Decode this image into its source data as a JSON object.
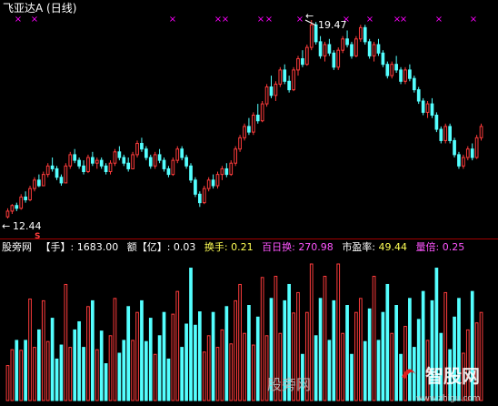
{
  "window": {
    "title": "飞亚达A (日线)"
  },
  "price_panel": {
    "high_label": "19.47",
    "low_label": "12.44",
    "signal_marker": "S",
    "x_marker_glyph": "×",
    "x_marker_count": 13
  },
  "info_bar": {
    "source": "股旁网",
    "volume_label": "【手】: 1683.00",
    "amount_label": "额【亿】: 0.03",
    "turnover_label": "换手: 0.21",
    "hundred_day_label": "百日换: ",
    "hundred_day_value": "270.98",
    "pe_label": "市盈率: ",
    "pe_value": "49.44",
    "volume_ratio_label": "量倍: ",
    "volume_ratio_value": "0.25"
  },
  "watermarks": {
    "center": "股旁网",
    "right": "智股网",
    "right_url": "www.zhigu.com"
  },
  "colors": {
    "up": "#ff3c3c",
    "down": "#54ffff",
    "marker": "#ff00ff",
    "label": "#ffffff",
    "divider": "#a00000",
    "hundred_day": "#ff55ff",
    "pe": "#ffff55",
    "volume_ratio": "#ff55ff",
    "source": "#ffffff"
  },
  "chart_data": {
    "type": "candlestick",
    "price_range": [
      12.44,
      19.47
    ],
    "candles": [
      [
        12.5,
        12.8,
        12.44,
        12.7
      ],
      [
        12.7,
        12.95,
        12.6,
        12.9
      ],
      [
        12.9,
        13.0,
        12.7,
        12.8
      ],
      [
        12.8,
        13.3,
        12.75,
        13.2
      ],
      [
        13.2,
        13.4,
        13.0,
        13.1
      ],
      [
        13.1,
        13.6,
        13.05,
        13.5
      ],
      [
        13.5,
        13.9,
        13.4,
        13.8
      ],
      [
        13.8,
        14.0,
        13.55,
        13.6
      ],
      [
        13.6,
        14.1,
        13.6,
        14.0
      ],
      [
        14.0,
        14.4,
        13.9,
        14.3
      ],
      [
        14.3,
        14.6,
        14.1,
        14.2
      ],
      [
        14.2,
        14.3,
        13.8,
        13.9
      ],
      [
        13.9,
        14.0,
        13.6,
        13.7
      ],
      [
        13.7,
        14.4,
        13.7,
        14.3
      ],
      [
        14.3,
        14.8,
        14.2,
        14.7
      ],
      [
        14.7,
        14.9,
        14.4,
        14.5
      ],
      [
        14.5,
        14.6,
        14.2,
        14.3
      ],
      [
        14.3,
        14.5,
        14.0,
        14.1
      ],
      [
        14.1,
        14.7,
        14.05,
        14.6
      ],
      [
        14.6,
        14.8,
        14.3,
        14.4
      ],
      [
        14.4,
        14.6,
        14.2,
        14.5
      ],
      [
        14.5,
        14.6,
        14.2,
        14.3
      ],
      [
        14.3,
        14.4,
        14.0,
        14.1
      ],
      [
        14.1,
        14.5,
        14.0,
        14.4
      ],
      [
        14.4,
        14.9,
        14.3,
        14.8
      ],
      [
        14.8,
        15.0,
        14.5,
        14.6
      ],
      [
        14.6,
        14.7,
        14.3,
        14.4
      ],
      [
        14.4,
        14.6,
        14.1,
        14.2
      ],
      [
        14.2,
        14.8,
        14.2,
        14.7
      ],
      [
        14.7,
        15.2,
        14.6,
        15.1
      ],
      [
        15.1,
        15.3,
        14.8,
        14.9
      ],
      [
        14.9,
        15.0,
        14.5,
        14.6
      ],
      [
        14.6,
        14.7,
        14.2,
        14.3
      ],
      [
        14.3,
        14.8,
        14.2,
        14.7
      ],
      [
        14.7,
        14.9,
        14.4,
        14.5
      ],
      [
        14.5,
        14.6,
        14.1,
        14.2
      ],
      [
        14.2,
        14.3,
        13.9,
        14.0
      ],
      [
        14.0,
        14.6,
        13.95,
        14.5
      ],
      [
        14.5,
        15.0,
        14.4,
        14.9
      ],
      [
        14.9,
        15.0,
        14.5,
        14.6
      ],
      [
        14.6,
        14.7,
        14.2,
        14.3
      ],
      [
        14.3,
        14.4,
        13.7,
        13.8
      ],
      [
        13.8,
        13.9,
        13.2,
        13.3
      ],
      [
        13.3,
        13.4,
        12.85,
        13.0
      ],
      [
        13.0,
        13.6,
        12.95,
        13.5
      ],
      [
        13.5,
        13.9,
        13.4,
        13.8
      ],
      [
        13.8,
        14.0,
        13.5,
        13.6
      ],
      [
        13.6,
        14.1,
        13.5,
        14.0
      ],
      [
        14.0,
        14.3,
        13.8,
        14.2
      ],
      [
        14.2,
        14.4,
        13.9,
        14.0
      ],
      [
        14.0,
        14.5,
        13.95,
        14.4
      ],
      [
        14.4,
        15.0,
        14.3,
        14.9
      ],
      [
        14.9,
        15.4,
        14.8,
        15.3
      ],
      [
        15.3,
        15.8,
        15.2,
        15.7
      ],
      [
        15.7,
        16.0,
        15.4,
        15.5
      ],
      [
        15.5,
        16.2,
        15.4,
        16.1
      ],
      [
        16.1,
        16.5,
        15.8,
        15.9
      ],
      [
        15.9,
        16.6,
        15.85,
        16.5
      ],
      [
        16.5,
        17.2,
        16.4,
        17.1
      ],
      [
        17.1,
        17.5,
        16.7,
        16.8
      ],
      [
        16.8,
        17.3,
        16.6,
        17.2
      ],
      [
        17.2,
        17.8,
        17.1,
        17.7
      ],
      [
        17.7,
        17.9,
        17.2,
        17.3
      ],
      [
        17.3,
        17.5,
        16.9,
        17.0
      ],
      [
        17.0,
        17.8,
        16.95,
        17.7
      ],
      [
        17.7,
        18.2,
        17.5,
        18.1
      ],
      [
        18.1,
        18.4,
        17.8,
        17.9
      ],
      [
        17.9,
        18.6,
        17.85,
        18.5
      ],
      [
        18.5,
        19.47,
        18.4,
        19.3
      ],
      [
        19.3,
        19.4,
        18.6,
        18.7
      ],
      [
        18.7,
        18.9,
        18.1,
        18.2
      ],
      [
        18.2,
        18.7,
        18.0,
        18.6
      ],
      [
        18.6,
        18.8,
        18.2,
        18.3
      ],
      [
        18.3,
        18.4,
        17.7,
        17.8
      ],
      [
        17.8,
        18.5,
        17.7,
        18.4
      ],
      [
        18.4,
        18.9,
        18.3,
        18.8
      ],
      [
        18.8,
        19.1,
        18.5,
        18.6
      ],
      [
        18.6,
        18.7,
        18.1,
        18.2
      ],
      [
        18.2,
        18.9,
        18.15,
        18.8
      ],
      [
        18.8,
        19.3,
        18.7,
        19.2
      ],
      [
        19.2,
        19.3,
        18.6,
        18.7
      ],
      [
        18.7,
        18.8,
        18.1,
        18.2
      ],
      [
        18.2,
        18.7,
        18.0,
        18.6
      ],
      [
        18.6,
        18.8,
        18.2,
        18.3
      ],
      [
        18.3,
        18.4,
        17.8,
        17.9
      ],
      [
        17.9,
        18.0,
        17.4,
        17.5
      ],
      [
        17.5,
        18.0,
        17.4,
        17.9
      ],
      [
        17.9,
        18.2,
        17.6,
        17.7
      ],
      [
        17.7,
        17.8,
        17.2,
        17.3
      ],
      [
        17.3,
        17.8,
        17.2,
        17.7
      ],
      [
        17.7,
        17.9,
        17.3,
        17.4
      ],
      [
        17.4,
        17.5,
        16.9,
        17.0
      ],
      [
        17.0,
        17.1,
        16.5,
        16.6
      ],
      [
        16.6,
        16.7,
        16.1,
        16.2
      ],
      [
        16.2,
        16.6,
        16.0,
        16.5
      ],
      [
        16.5,
        16.7,
        16.0,
        16.1
      ],
      [
        16.1,
        16.2,
        15.5,
        15.6
      ],
      [
        15.6,
        15.7,
        15.1,
        15.2
      ],
      [
        15.2,
        15.8,
        15.1,
        15.7
      ],
      [
        15.7,
        15.8,
        15.1,
        15.2
      ],
      [
        15.2,
        15.3,
        14.6,
        14.7
      ],
      [
        14.7,
        14.8,
        14.2,
        14.3
      ],
      [
        14.3,
        14.7,
        14.2,
        14.6
      ],
      [
        14.6,
        15.0,
        14.5,
        14.9
      ],
      [
        14.9,
        15.1,
        14.5,
        14.6
      ],
      [
        14.6,
        15.4,
        14.55,
        15.3
      ],
      [
        15.3,
        15.8,
        15.2,
        15.7
      ]
    ]
  }
}
